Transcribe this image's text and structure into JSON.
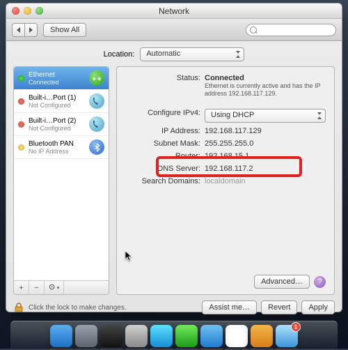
{
  "window": {
    "title": "Network",
    "toolbar": {
      "back_aria": "Back",
      "forward_aria": "Forward",
      "show_all": "Show All",
      "search_placeholder": ""
    }
  },
  "location": {
    "label": "Location:",
    "value": "Automatic"
  },
  "sidebar": {
    "items": [
      {
        "name": "Ethernet",
        "status": "Connected",
        "dot": "g",
        "icon": "<>"
      },
      {
        "name": "Built-i…Port (1)",
        "status": "Not Configured",
        "dot": "r",
        "icon": "phone"
      },
      {
        "name": "Built-i…Port (2)",
        "status": "Not Configured",
        "dot": "r",
        "icon": "phone"
      },
      {
        "name": "Bluetooth PAN",
        "status": "No IP Address",
        "dot": "y",
        "icon": "bt"
      }
    ]
  },
  "details": {
    "status_label": "Status:",
    "status_value": "Connected",
    "status_desc1": "Ethernet is currently active and has the IP",
    "status_desc2": "address 192.168.117.129.",
    "configure_label": "Configure IPv4:",
    "configure_value": "Using DHCP",
    "ip_label": "IP Address:",
    "ip_value": "192.168.117.129",
    "subnet_label": "Subnet Mask:",
    "subnet_value": "255.255.255.0",
    "router_label": "Router:",
    "router_value": "192.168.15.1",
    "dns_label": "DNS Server:",
    "dns_value": "192.168.117.2",
    "search_label": "Search Domains:",
    "search_value": "localdomain",
    "advanced": "Advanced…"
  },
  "footer": {
    "lock_text": "Click the lock to make changes.",
    "assist": "Assist me…",
    "revert": "Revert",
    "apply": "Apply"
  },
  "dock": {
    "items": [
      {
        "name": "finder",
        "bg": "linear-gradient(#58b0ef,#1e6ec6)"
      },
      {
        "name": "launchpad",
        "bg": "linear-gradient(#9aa3ad,#5a646e)"
      },
      {
        "name": "appstore",
        "bg": "linear-gradient(#444,#111)"
      },
      {
        "name": "settings",
        "bg": "linear-gradient(#cfcfcf,#8a8a8a)"
      },
      {
        "name": "imessage",
        "bg": "linear-gradient(#5fe0ff,#128fd6)"
      },
      {
        "name": "facetime",
        "bg": "linear-gradient(#6fea58,#1b9a1b)"
      },
      {
        "name": "itunes",
        "bg": "linear-gradient(#6fc2f4,#1f7acb)"
      },
      {
        "name": "calendar",
        "bg": "radial-gradient(#fff 40%,#eee)"
      },
      {
        "name": "photobooth",
        "bg": "linear-gradient(#f7b44e,#d67f14)"
      },
      {
        "name": "safari",
        "bg": "linear-gradient(#aee1fb,#3a94d8)",
        "badge": "1"
      }
    ]
  }
}
